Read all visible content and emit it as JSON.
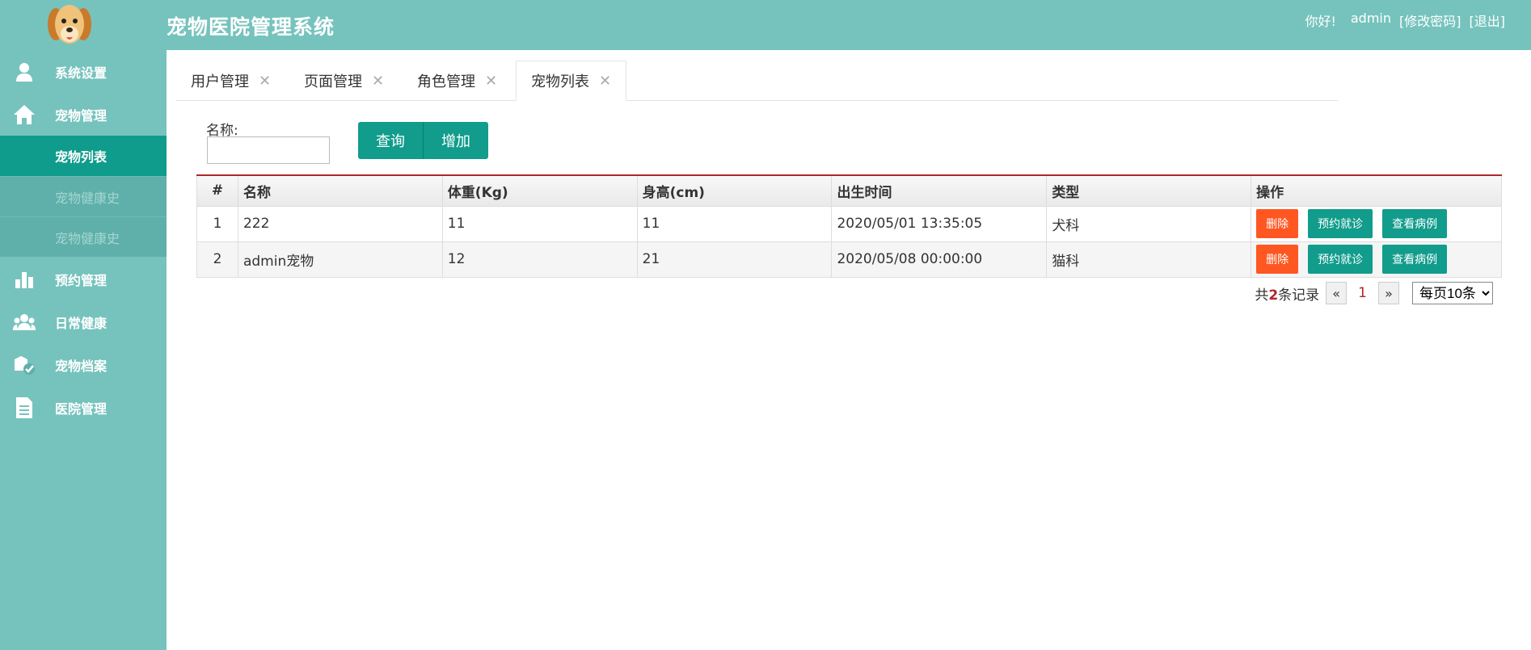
{
  "header": {
    "title": "宠物医院管理系统",
    "greeting": "你好!",
    "username": "admin",
    "change_password": "[修改密码]",
    "logout": "[退出]"
  },
  "sidebar": {
    "items": [
      {
        "label": "系统设置",
        "icon": "user-settings-icon"
      },
      {
        "label": "宠物管理",
        "icon": "home-icon"
      },
      {
        "label": "预约管理",
        "icon": "bar-chart-icon"
      },
      {
        "label": "日常健康",
        "icon": "group-icon"
      },
      {
        "label": "宠物档案",
        "icon": "archive-check-icon"
      },
      {
        "label": "医院管理",
        "icon": "document-icon"
      }
    ],
    "sub_items": [
      {
        "label": "宠物列表",
        "state": "active"
      },
      {
        "label": "宠物健康史",
        "state": "muted"
      },
      {
        "label": "宠物健康史",
        "state": "muted"
      }
    ]
  },
  "tabs": [
    {
      "label": "用户管理",
      "active": false
    },
    {
      "label": "页面管理",
      "active": false
    },
    {
      "label": "角色管理",
      "active": false
    },
    {
      "label": "宠物列表",
      "active": true
    }
  ],
  "search": {
    "label": "名称:",
    "value": "",
    "query_button": "查询",
    "add_button": "增加"
  },
  "table": {
    "columns": [
      "#",
      "名称",
      "体重(Kg)",
      "身高(cm)",
      "出生时间",
      "类型",
      "操作"
    ],
    "rows": [
      {
        "num": "1",
        "name": "222",
        "weight": "11",
        "height": "11",
        "birth": "2020/05/01 13:35:05",
        "type": "犬科"
      },
      {
        "num": "2",
        "name": "admin宠物",
        "weight": "12",
        "height": "21",
        "birth": "2020/05/08 00:00:00",
        "type": "猫科"
      }
    ],
    "actions": {
      "delete": "删除",
      "appointment": "预约就诊",
      "view_cases": "查看病例"
    }
  },
  "pager": {
    "prefix": "共",
    "count": "2",
    "suffix": "条记录",
    "prev": "«",
    "current": "1",
    "next": "»",
    "page_size": "每页10条"
  },
  "colors": {
    "header_bg": "#76c3bd",
    "accent_green": "#119c8c",
    "delete_orange": "#ff5722",
    "table_top_border": "#b0262a"
  }
}
